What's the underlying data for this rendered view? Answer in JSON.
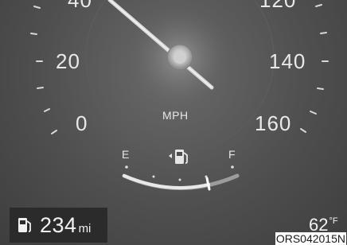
{
  "speedometer": {
    "labels": {
      "s40": "40",
      "s20": "20",
      "s0": "0",
      "s120": "120",
      "s140": "140",
      "s160": "160"
    },
    "unit": "MPH"
  },
  "fuel": {
    "empty_label": "E",
    "full_label": "F",
    "level": 0.8,
    "icon": "fuel-pump-icon"
  },
  "range": {
    "value": "234",
    "unit": "mi",
    "icon": "fuel-pump-icon"
  },
  "temperature": {
    "value": "62",
    "unit": "°F"
  },
  "image_code": "ORS042015N",
  "colors": {
    "background": "#555555",
    "text": "#e9e9e9",
    "needle": "#d6d6d6"
  }
}
